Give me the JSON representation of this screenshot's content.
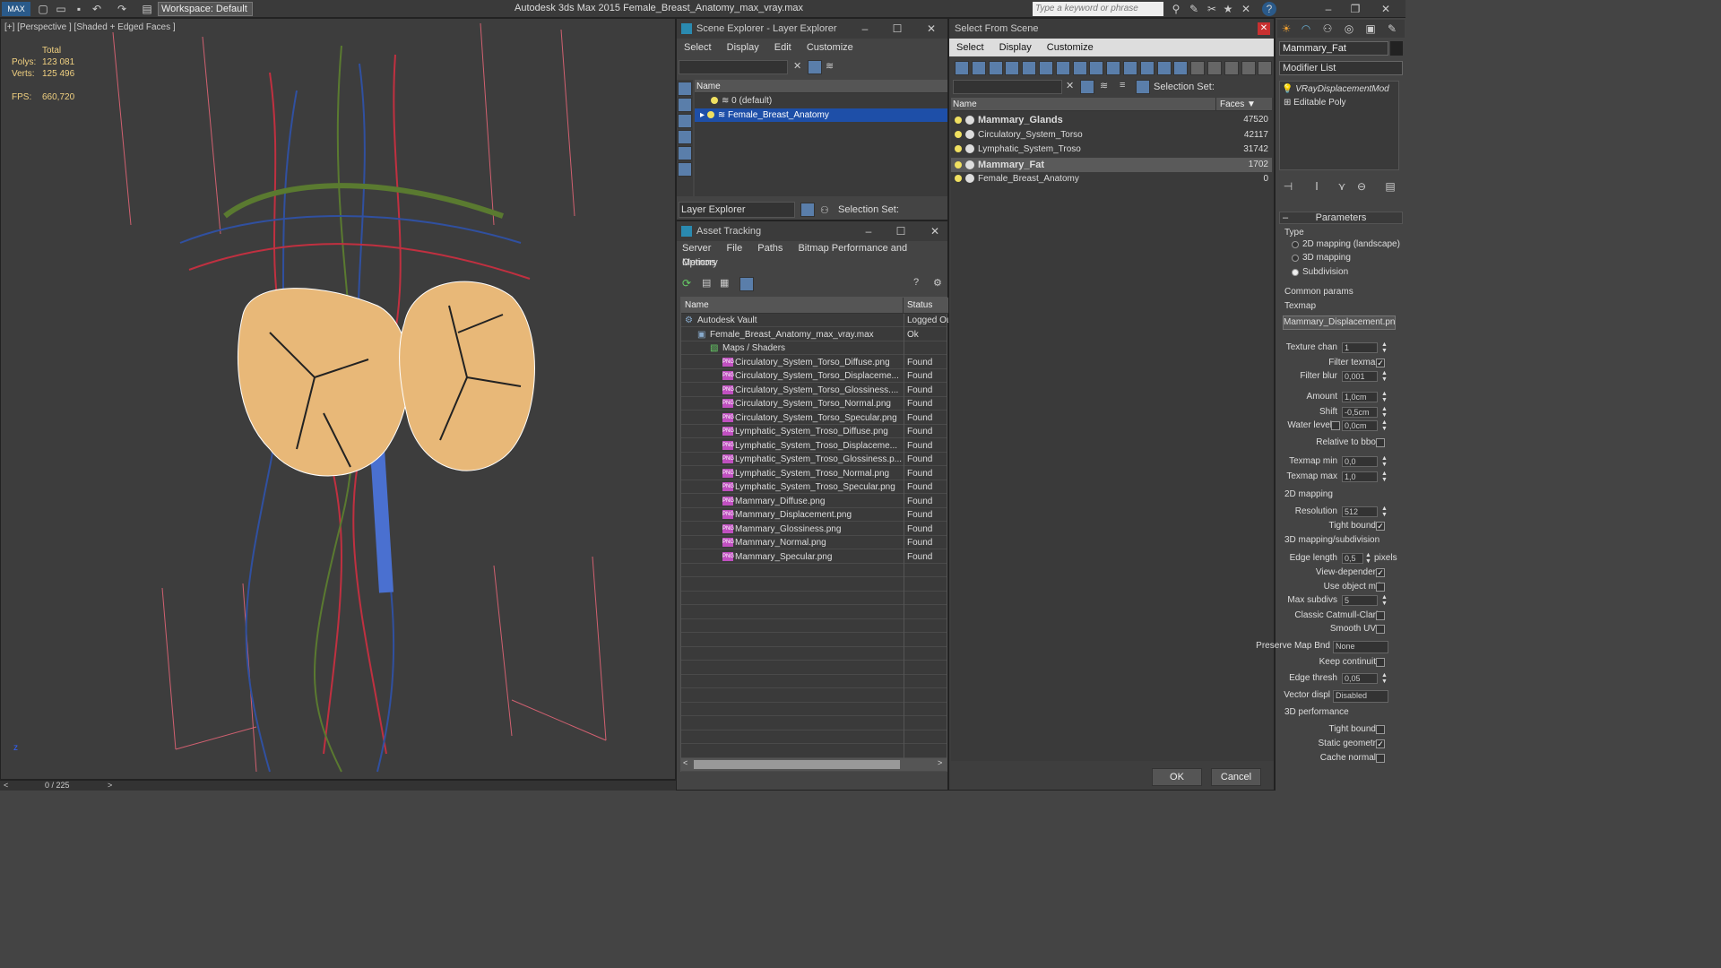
{
  "app": {
    "title": "Autodesk 3ds Max  2015     Female_Breast_Anatomy_max_vray.max",
    "workspace": "Workspace: Default",
    "search_placeholder": "Type a keyword or phrase"
  },
  "viewport": {
    "label": "[+] [Perspective ] [Shaded + Edged Faces ]",
    "stats": {
      "total_label": "Total",
      "polys_label": "Polys:",
      "polys_value": "123 081",
      "verts_label": "Verts:",
      "verts_value": "125 496",
      "fps_label": "FPS:",
      "fps_value": "660,720"
    },
    "timeline": "0 / 225"
  },
  "scene_explorer": {
    "title": "Scene Explorer - Layer Explorer",
    "menu": [
      "Select",
      "Display",
      "Edit",
      "Customize"
    ],
    "column": "Name",
    "rows": [
      "0 (default)",
      "Female_Breast_Anatomy"
    ],
    "footer_dropdown": "Layer Explorer",
    "selection_set": "Selection Set:"
  },
  "asset_tracking": {
    "title": "Asset Tracking",
    "menu": [
      "Server",
      "File",
      "Paths",
      "Bitmap Performance and Memory"
    ],
    "menu2": "Options",
    "col_name": "Name",
    "col_status": "Status",
    "rows": [
      {
        "name": "Autodesk Vault",
        "status": "Logged Ou",
        "indent": 0
      },
      {
        "name": "Female_Breast_Anatomy_max_vray.max",
        "status": "Ok",
        "indent": 1
      },
      {
        "name": "Maps / Shaders",
        "status": "",
        "indent": 2
      },
      {
        "name": "Circulatory_System_Torso_Diffuse.png",
        "status": "Found",
        "indent": 3
      },
      {
        "name": "Circulatory_System_Torso_Displaceme...",
        "status": "Found",
        "indent": 3
      },
      {
        "name": "Circulatory_System_Torso_Glossiness....",
        "status": "Found",
        "indent": 3
      },
      {
        "name": "Circulatory_System_Torso_Normal.png",
        "status": "Found",
        "indent": 3
      },
      {
        "name": "Circulatory_System_Torso_Specular.png",
        "status": "Found",
        "indent": 3
      },
      {
        "name": "Lymphatic_System_Troso_Diffuse.png",
        "status": "Found",
        "indent": 3
      },
      {
        "name": "Lymphatic_System_Troso_Displaceme...",
        "status": "Found",
        "indent": 3
      },
      {
        "name": "Lymphatic_System_Troso_Glossiness.p...",
        "status": "Found",
        "indent": 3
      },
      {
        "name": "Lymphatic_System_Troso_Normal.png",
        "status": "Found",
        "indent": 3
      },
      {
        "name": "Lymphatic_System_Troso_Specular.png",
        "status": "Found",
        "indent": 3
      },
      {
        "name": "Mammary_Diffuse.png",
        "status": "Found",
        "indent": 3
      },
      {
        "name": "Mammary_Displacement.png",
        "status": "Found",
        "indent": 3
      },
      {
        "name": "Mammary_Glossiness.png",
        "status": "Found",
        "indent": 3
      },
      {
        "name": "Mammary_Normal.png",
        "status": "Found",
        "indent": 3
      },
      {
        "name": "Mammary_Specular.png",
        "status": "Found",
        "indent": 3
      }
    ]
  },
  "select_from_scene": {
    "title": "Select From Scene",
    "menu": [
      "Select",
      "Display",
      "Customize"
    ],
    "selection_set": "Selection Set:",
    "col_name": "Name",
    "col_faces": "Faces",
    "rows": [
      {
        "name": "Mammary_Glands",
        "faces": "47520",
        "bold": true
      },
      {
        "name": "Circulatory_System_Torso",
        "faces": "42117",
        "bold": false
      },
      {
        "name": "Lymphatic_System_Troso",
        "faces": "31742",
        "bold": false
      },
      {
        "name": "Mammary_Fat",
        "faces": "1702",
        "bold": true
      },
      {
        "name": "Female_Breast_Anatomy",
        "faces": "0",
        "bold": false
      }
    ],
    "ok": "OK",
    "cancel": "Cancel"
  },
  "command_panel": {
    "object_name": "Mammary_Fat",
    "modifier_list": "Modifier List",
    "stack": [
      "VRayDisplacementMod",
      "Editable Poly"
    ],
    "rollout_title": "Parameters",
    "type_label": "Type",
    "type_options": [
      "2D mapping (landscape)",
      "3D mapping",
      "Subdivision"
    ],
    "common_params": "Common params",
    "texmap_label": "Texmap",
    "texmap_value": "Mammary_Displacement.png)",
    "texture_chan_label": "Texture chan",
    "texture_chan": "1",
    "filter_texmap": "Filter texmap",
    "filter_blur_label": "Filter blur",
    "filter_blur": "0,001",
    "amount_label": "Amount",
    "amount": "1,0cm",
    "shift_label": "Shift",
    "shift": "-0,5cm",
    "water_level_label": "Water level",
    "water_level": "0,0cm",
    "relative_bbox": "Relative to bbox",
    "texmap_min_label": "Texmap min",
    "texmap_min": "0,0",
    "texmap_max_label": "Texmap max",
    "texmap_max": "1,0",
    "mapping2d": "2D mapping",
    "resolution_label": "Resolution",
    "resolution": "512",
    "tight_bounds": "Tight bounds",
    "mapping3d": "3D mapping/subdivision",
    "edge_length_label": "Edge length",
    "edge_length": "0,5",
    "pixels": "pixels",
    "view_dependent": "View-dependent",
    "use_object_mtl": "Use object mtl",
    "max_subdivs_label": "Max subdivs",
    "max_subdivs": "5",
    "classic_catmull": "Classic Catmull-Clark",
    "smooth_uvs": "Smooth UVs",
    "preserve_map_label": "Preserve Map Bnd",
    "preserve_map": "None",
    "keep_continuity": "Keep continuity",
    "edge_thresh_label": "Edge thresh",
    "edge_thresh": "0,05",
    "vector_displ_label": "Vector displ",
    "vector_displ": "Disabled",
    "perf3d": "3D performance",
    "tight_bounds2": "Tight bounds",
    "static_geometry": "Static geometry",
    "cache_normals": "Cache normals"
  }
}
